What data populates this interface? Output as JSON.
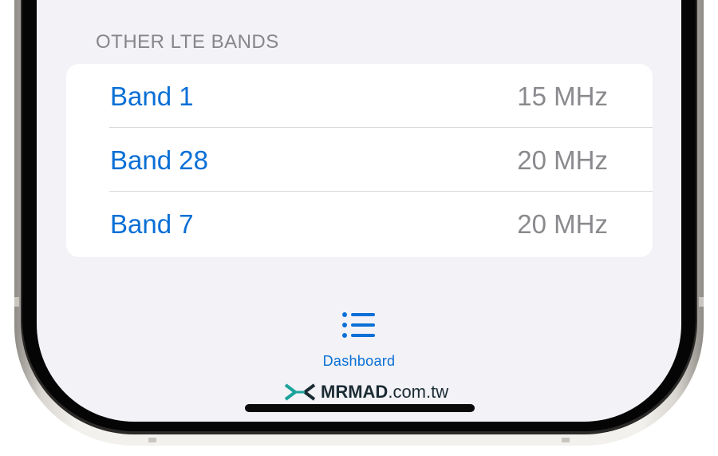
{
  "section": {
    "header": "OTHER LTE BANDS",
    "rows": [
      {
        "label": "Band 1",
        "value": "15 MHz"
      },
      {
        "label": "Band 28",
        "value": "20 MHz"
      },
      {
        "label": "Band 7",
        "value": "20 MHz"
      }
    ]
  },
  "tabbar": {
    "dashboard_label": "Dashboard",
    "dashboard_icon": "list-icon"
  },
  "watermark": {
    "brand": "MRMAD",
    "domain": ".com.tw"
  },
  "colors": {
    "accent": "#0a6fd6",
    "screen_bg": "#f2f2f7",
    "value_gray": "#8a8a8e",
    "header_gray": "#86868b",
    "watermark_teal": "#1aa39a"
  }
}
